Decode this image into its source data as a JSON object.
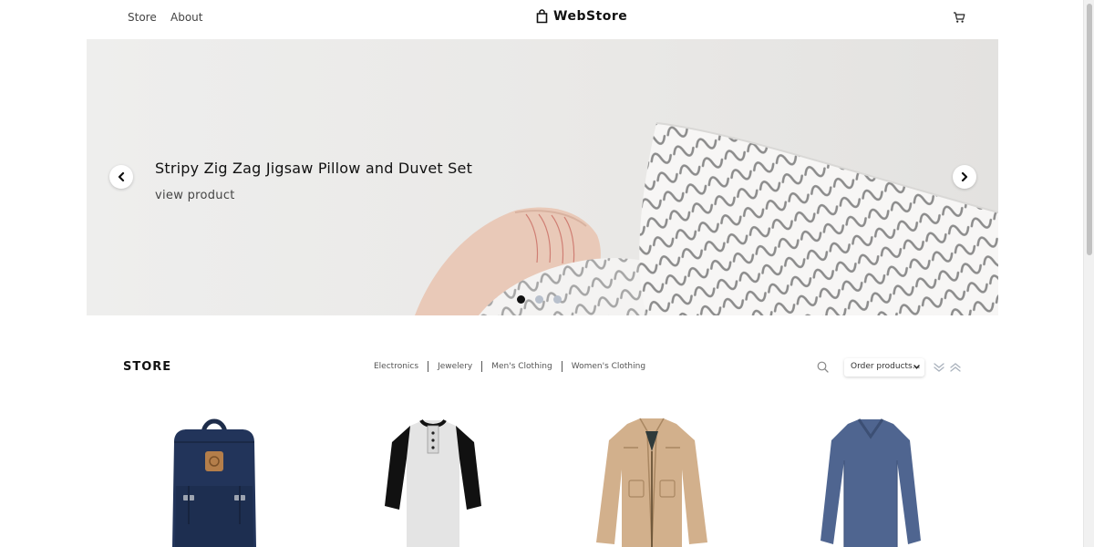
{
  "nav": {
    "links": [
      "Store",
      "About"
    ],
    "brand": "WebStore",
    "brand_icon": "shopping-bag-icon",
    "cart_icon": "cart-icon"
  },
  "hero": {
    "title": "Stripy Zig Zag Jigsaw Pillow and Duvet Set",
    "link": "view product",
    "slide_count": 3,
    "active_slide": 1,
    "prev_icon": "chevron-left-icon",
    "next_icon": "chevron-right-icon"
  },
  "store": {
    "title": "STORE",
    "categories": [
      "Electronics",
      "Jewelery",
      "Men's Clothing",
      "Women's Clothing"
    ],
    "search_icon": "search-icon",
    "order_select": "Order products...",
    "sort_desc_icon": "sort-descending-icon",
    "sort_asc_icon": "sort-ascending-icon"
  },
  "products": [
    {
      "image": "navy-backpack"
    },
    {
      "image": "raglan-henley-shirt"
    },
    {
      "image": "khaki-jacket"
    },
    {
      "image": "blue-long-sleeve-shirt"
    }
  ],
  "colors": {
    "hero_bg": "#ecebea",
    "dot_active": "#111111",
    "dot_inactive": "#b8c0cc"
  }
}
